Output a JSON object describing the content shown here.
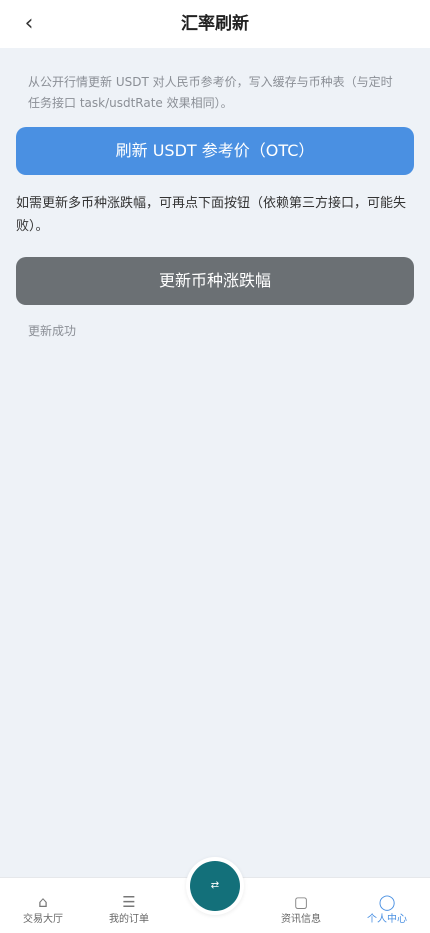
{
  "header": {
    "back_icon": "‹",
    "title": "汇率刷新"
  },
  "main": {
    "description": "从公开行情更新 USDT 对人民币参考价，写入缓存与币种表（与定时任务接口 task/usdtRate 效果相同）。",
    "otc_button_label": "刷新 USDT 参考价（OTC）",
    "info_text": "如需更新多币种涨跌幅，可再点下面按钮（依赖第三方接口，可能失败）。",
    "change_button_label": "更新币种涨跌幅",
    "status_text": "更新成功"
  },
  "tabbar": {
    "items": [
      {
        "label": "交易大厅",
        "icon": "⌂"
      },
      {
        "label": "我的订单",
        "icon": "☰"
      },
      {
        "label": "资讯信息",
        "icon": "▢"
      },
      {
        "label": "个人中心",
        "icon": "◯"
      }
    ],
    "center_icon": "⇄",
    "active_color": "#4a90e2"
  },
  "colors": {
    "primary_button": "#4a90e2",
    "secondary_button": "#6b7074",
    "center_button": "#13707a"
  }
}
